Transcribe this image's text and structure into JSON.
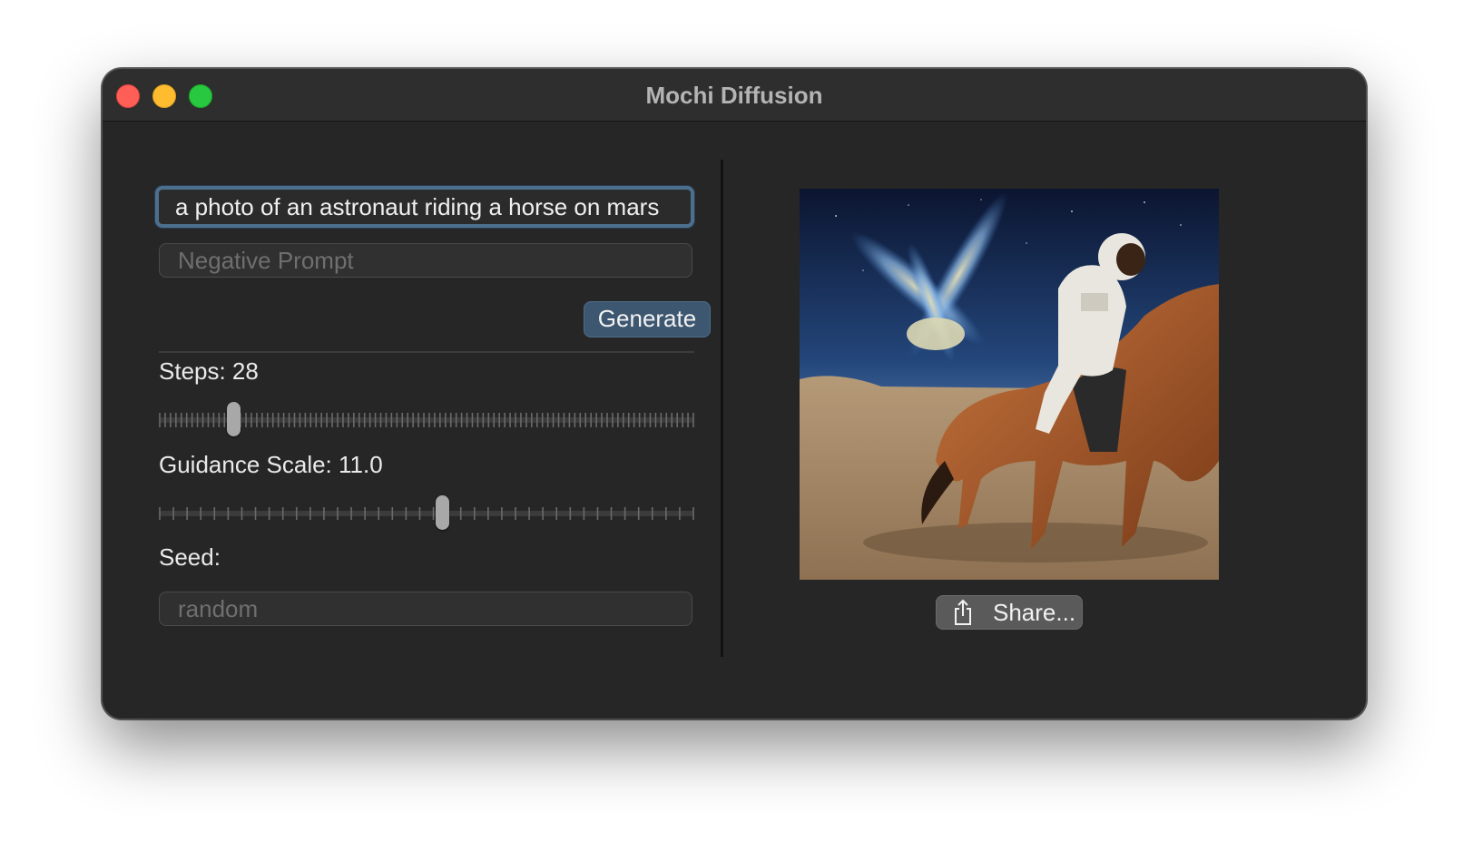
{
  "window": {
    "title": "Mochi Diffusion"
  },
  "prompt": {
    "value": "a photo of an astronaut riding a horse on mars"
  },
  "negative_prompt": {
    "placeholder": "Negative Prompt"
  },
  "generate_button": {
    "label": "Generate"
  },
  "steps": {
    "label": "Steps: 28",
    "fraction": 0.13
  },
  "guidance": {
    "label": "Guidance Scale: 11.0",
    "fraction": 0.53
  },
  "seed": {
    "label": "Seed:",
    "placeholder": "random"
  },
  "share_button": {
    "label": "Share...",
    "icon": "share-icon"
  },
  "colors": {
    "accent": "#3d5770",
    "focus_ring": "#4d6f8e",
    "window_bg": "#262626"
  }
}
